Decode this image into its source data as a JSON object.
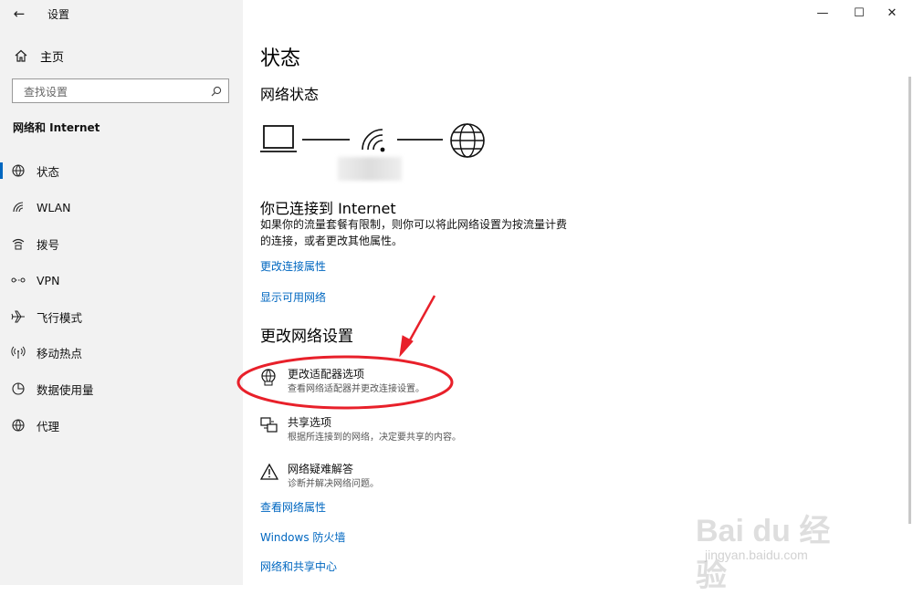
{
  "window": {
    "title": "设置",
    "back_glyph": "←",
    "minimize_glyph": "—",
    "maximize_glyph": "☐",
    "close_glyph": "✕"
  },
  "sidebar": {
    "home_label": "主页",
    "search_placeholder": "查找设置",
    "section_title": "网络和 Internet",
    "items": [
      {
        "label": "状态",
        "icon": "globe-status-icon",
        "active": true
      },
      {
        "label": "WLAN",
        "icon": "wifi-icon",
        "active": false
      },
      {
        "label": "拨号",
        "icon": "dialup-icon",
        "active": false
      },
      {
        "label": "VPN",
        "icon": "vpn-icon",
        "active": false
      },
      {
        "label": "飞行模式",
        "icon": "airplane-icon",
        "active": false
      },
      {
        "label": "移动热点",
        "icon": "hotspot-icon",
        "active": false
      },
      {
        "label": "数据使用量",
        "icon": "data-usage-icon",
        "active": false
      },
      {
        "label": "代理",
        "icon": "globe-icon",
        "active": false
      }
    ]
  },
  "main": {
    "page_title": "状态",
    "network_status_heading": "网络状态",
    "connected_title": "你已连接到 Internet",
    "connected_desc": "如果你的流量套餐有限制，则你可以将此网络设置为按流量计费的连接，或者更改其他属性。",
    "link_change_properties": "更改连接属性",
    "link_show_networks": "显示可用网络",
    "change_settings_heading": "更改网络设置",
    "options": [
      {
        "title": "更改适配器选项",
        "desc": "查看网络适配器并更改连接设置。",
        "icon": "adapter-icon"
      },
      {
        "title": "共享选项",
        "desc": "根据所连接到的网络，决定要共享的内容。",
        "icon": "sharing-icon"
      },
      {
        "title": "网络疑难解答",
        "desc": "诊断并解决网络问题。",
        "icon": "warning-icon"
      }
    ],
    "link_view_properties": "查看网络属性",
    "link_firewall": "Windows 防火墙",
    "link_sharing_center": "网络和共享中心"
  },
  "watermark": {
    "brand": "Bai du 经验",
    "url": "jingyan.baidu.com"
  },
  "colors": {
    "accent": "#0067c0",
    "annotation": "#e8202a",
    "sidebar_bg": "#f2f2f2"
  }
}
